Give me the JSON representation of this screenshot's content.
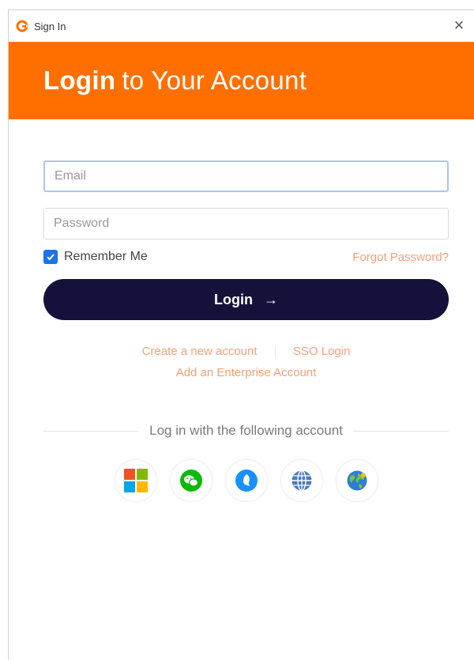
{
  "window": {
    "title": "Sign In",
    "close_symbol": "×"
  },
  "header": {
    "title_strong": "Login",
    "title_rest": "to Your Account",
    "background_color": "#ff6f00"
  },
  "form": {
    "email": {
      "placeholder": "Email",
      "value": ""
    },
    "password": {
      "placeholder": "Password",
      "value": ""
    },
    "remember_me": {
      "label": "Remember Me",
      "checked": true
    },
    "forgot_password": "Forgot Password?",
    "login_button": {
      "label": "Login",
      "arrow": "→",
      "color": "#14123a"
    }
  },
  "links": {
    "create_account": "Create a new account",
    "sso_login": "SSO Login",
    "enterprise_account": "Add an Enterprise Account",
    "color": "#f5a07a"
  },
  "social": {
    "divider_text": "Log in with the following account",
    "providers": [
      {
        "icon": "microsoft-icon"
      },
      {
        "icon": "wechat-icon"
      },
      {
        "icon": "dingtalk-icon"
      },
      {
        "icon": "globe-icon"
      },
      {
        "icon": "earth-icon"
      }
    ]
  }
}
